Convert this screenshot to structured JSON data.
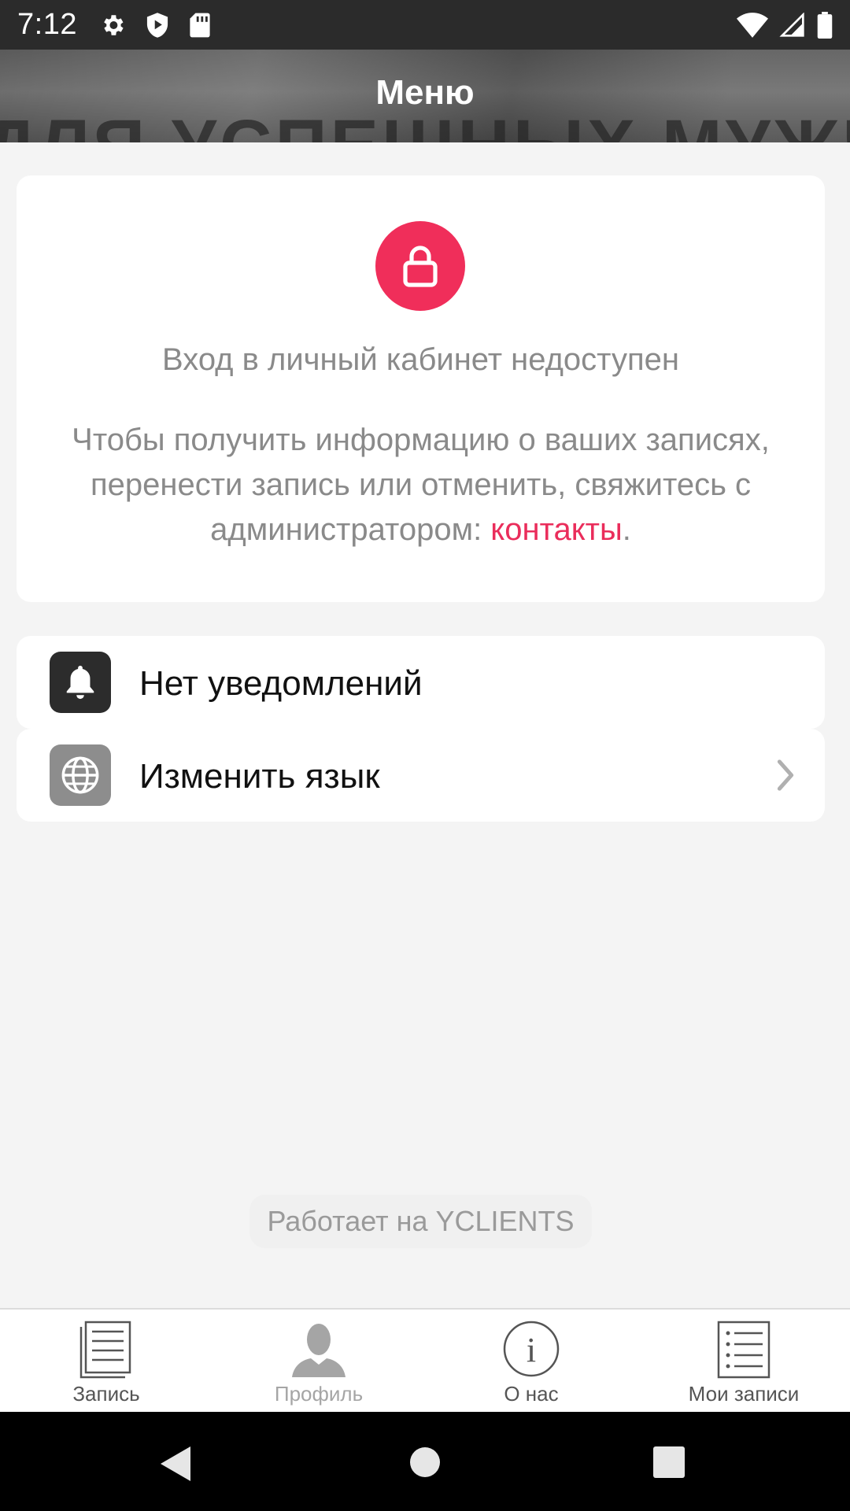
{
  "status_bar": {
    "time": "7:12",
    "left_icons": [
      "gear-icon",
      "shield-play-icon",
      "sd-card-icon"
    ],
    "right_icons": [
      "wifi-icon",
      "cell-signal-icon",
      "battery-icon"
    ]
  },
  "header": {
    "title": "Меню",
    "background_text": "ДЛЯ УСПЕШНЫХ МУЖЧИН"
  },
  "login_card": {
    "icon": "lock-icon",
    "icon_bg_color": "#f02e5a",
    "title": "Вход в личный кабинет недоступен",
    "description": "Чтобы получить информацию о ваших записях, перенести запись или отменить, свяжитесь с администратором: ",
    "contacts_link": "контакты",
    "trailing": ".",
    "link_color": "#ea2d5b"
  },
  "menu_items": [
    {
      "icon": "bell-icon",
      "label": "Нет уведомлений",
      "has_chevron": false
    },
    {
      "icon": "globe-icon",
      "label": "Изменить язык",
      "has_chevron": true
    }
  ],
  "powered_by": "Работает на YCLIENTS",
  "bottom_nav": [
    {
      "icon": "booking-list-icon",
      "label": "Запись",
      "active": true
    },
    {
      "icon": "profile-icon",
      "label": "Профиль",
      "active": false
    },
    {
      "icon": "info-icon",
      "label": "О нас",
      "active": true
    },
    {
      "icon": "my-bookings-icon",
      "label": "Мои записи",
      "active": true
    }
  ],
  "system_nav": [
    "back-icon",
    "home-icon",
    "recents-icon"
  ]
}
